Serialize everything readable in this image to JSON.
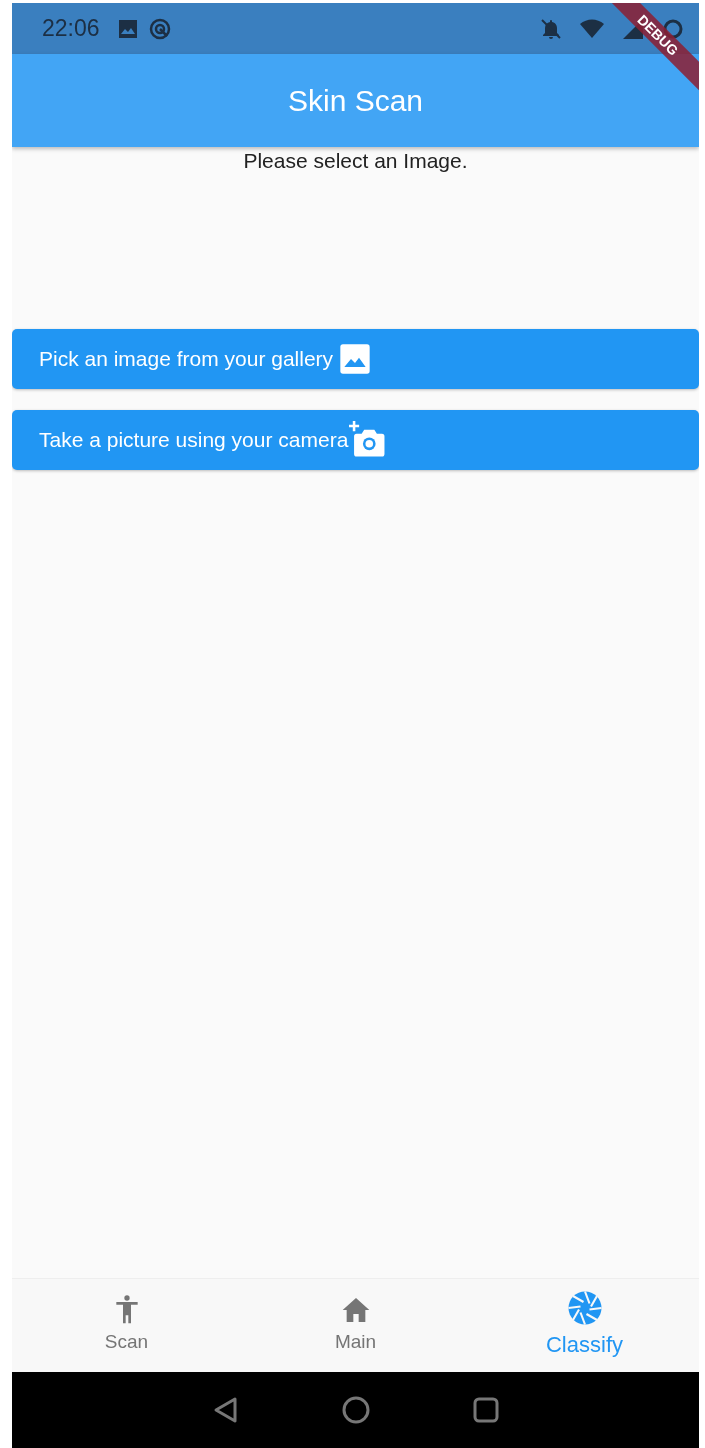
{
  "status_bar": {
    "time": "22:06"
  },
  "debug_banner": {
    "label": "DEBUG"
  },
  "app_bar": {
    "title": "Skin Scan"
  },
  "prompt": "Please select an Image.",
  "buttons": [
    {
      "label": "Pick an image from your gallery",
      "kind": "gallery"
    },
    {
      "label": "Take a picture using your camera",
      "kind": "camera"
    }
  ],
  "bottom_nav": [
    {
      "label": "Scan",
      "kind": "person",
      "selected": false
    },
    {
      "label": "Main",
      "kind": "home",
      "selected": false
    },
    {
      "label": "Classify",
      "kind": "shutter",
      "selected": true
    }
  ]
}
